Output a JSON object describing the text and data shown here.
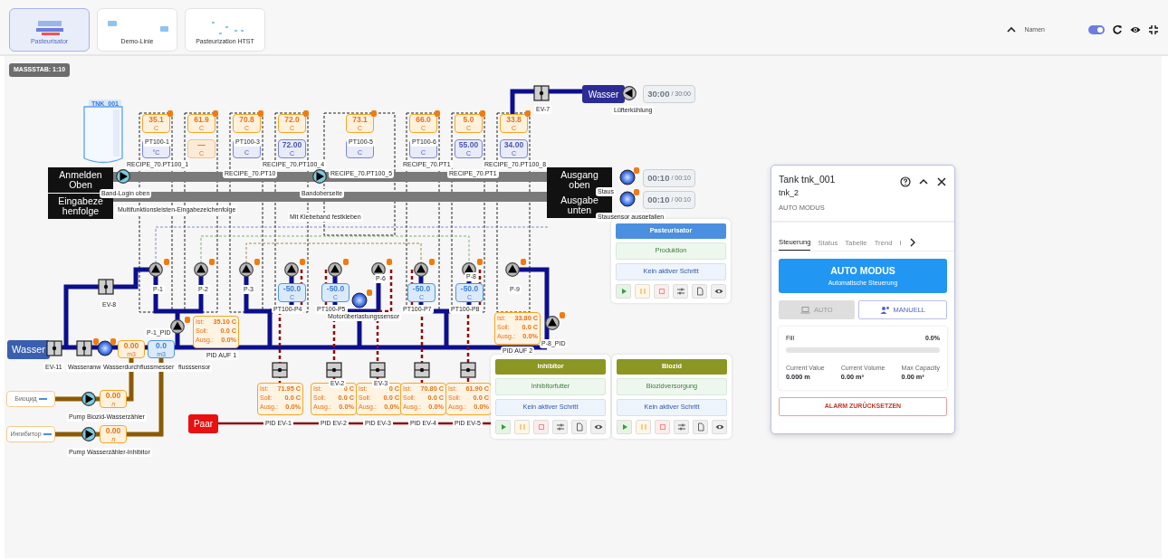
{
  "tabs": [
    {
      "label": "Pasteurisator",
      "selected": true
    },
    {
      "label": "Demo-Linie",
      "selected": false
    },
    {
      "label": "Pasteurization HTST",
      "selected": false
    }
  ],
  "toolbar": {
    "names_label": "Namen",
    "names_on": true
  },
  "scale": "MASSSTAB: 1:10",
  "tank": {
    "label": "TNK_001"
  },
  "sensors": [
    {
      "value": "35.1",
      "unit": "C",
      "set": {
        "unit": "°C",
        "kind": "normal"
      },
      "tag": "PT100-1",
      "recipe": "RECIPE_70.PT100_1"
    },
    {
      "value": "61.9",
      "unit": "C",
      "set": {
        "value": "—",
        "unit": "C",
        "kind": "warn"
      }
    },
    {
      "value": "70.8",
      "unit": "C",
      "set": {
        "unit": "C",
        "kind": "normal"
      },
      "tag": "PT100-3",
      "recipe": "RECIPE_70.PT10"
    },
    {
      "value": "72.0",
      "unit": "C",
      "set": {
        "value": "72.00",
        "unit": "C",
        "kind": "normal"
      },
      "recipe": "RECIPE_70.PT100_4"
    },
    {
      "value": "73.1",
      "unit": "C",
      "set": {
        "unit": "C",
        "kind": "normal"
      },
      "tag": "PT100-5",
      "recipe": "RECIPE_70.PT100_5"
    },
    {
      "value": "66.0",
      "unit": "C",
      "set": {
        "unit": "C",
        "kind": "normal"
      },
      "tag": "PT100-6",
      "recipe": "RECIPE_70.PT1"
    },
    {
      "value": "5.0",
      "unit": "C",
      "set": {
        "value": "55.00",
        "unit": "C",
        "kind": "normal"
      },
      "recipe": "RECIPE_70.PT1"
    },
    {
      "value": "33.8",
      "unit": "C",
      "set": {
        "value": "34.00",
        "unit": "C",
        "kind": "normal"
      },
      "recipe": "RECIPE_70.PT100_8"
    }
  ],
  "conveyor": {
    "inlets": [
      [
        "Anmelden",
        "Oben"
      ],
      [
        "Eingabeze",
        "henfolge"
      ]
    ],
    "outlets": [
      [
        "Ausgang",
        "oben"
      ],
      [
        "Ausgabe",
        "unten"
      ]
    ],
    "pumps": [
      {
        "label": "Band-Login oben"
      },
      {
        "label": "Multifunktionsleisten-Eingabezeichenfolge"
      },
      {
        "label": "Bandoberseite"
      },
      {
        "label": "Mit Klebeband festkleben"
      }
    ],
    "outlet_sensors": [
      {
        "label": "Staus",
        "time": "00:10",
        "total": "/ 00:10"
      },
      {
        "label": "Stausensor ausgefallen",
        "time": "00:10",
        "total": "/ 00:10"
      }
    ]
  },
  "cooling": {
    "source": "Wasser",
    "valve": "EV-7",
    "pump": "Lüfterkühlung",
    "time": "30:00",
    "total": "/ 30:00"
  },
  "pumps": [
    {
      "kind": "pump",
      "label": "P-1"
    },
    {
      "kind": "pump",
      "label": "P-2"
    },
    {
      "kind": "pump",
      "label": "P-3"
    },
    {
      "kind": "pump"
    },
    {
      "kind": "pump"
    },
    {
      "kind": "pump",
      "label": "P-6"
    },
    {
      "kind": "pump"
    },
    {
      "kind": "pump",
      "label": "P-8"
    },
    {
      "kind": "pump",
      "label": "P-9"
    }
  ],
  "probes": [
    {
      "value": "-50.0",
      "unit": "C",
      "label": "PT100-P4"
    },
    {
      "value": "-50.0",
      "unit": "C",
      "label": "PT100-P5"
    },
    {
      "value": "-50.0",
      "unit": "C",
      "label": "PT100-P7"
    },
    {
      "value": "-50.0",
      "unit": "C",
      "label": "PT100-P8"
    }
  ],
  "motor_sensor": "Motorüberlastungssensor",
  "pid_pumps": [
    {
      "label": "P-1_PID"
    },
    {
      "label": "P-8_PID"
    }
  ],
  "pids": [
    {
      "label": "PID AUF 1",
      "rows": [
        {
          "key": "Ist:",
          "value": "35.10 C"
        },
        {
          "key": "Soll:",
          "value": "0.0 C"
        },
        {
          "key": "Ausg.:",
          "value": "0.0%"
        }
      ]
    },
    {
      "label": "PID AUF 2",
      "rows": [
        {
          "key": "Ist:",
          "value": "33.80 C"
        },
        {
          "key": "Soll:",
          "value": "0.0 C"
        },
        {
          "key": "Ausg.:",
          "value": "0.0%"
        }
      ]
    },
    {
      "label": "PID EV-1",
      "rows": [
        {
          "key": "Ist:",
          "value": "71.95 C"
        },
        {
          "key": "Soll:",
          "value": "0.0 C"
        },
        {
          "key": "Ausg.:",
          "value": "0.0%"
        }
      ]
    },
    {
      "label": "PID EV-2",
      "rows": [
        {
          "key": "Ist:",
          "value": "0 C"
        },
        {
          "key": "Soll:",
          "value": "0.0 C"
        },
        {
          "key": "Ausg.:",
          "value": "0.0%"
        }
      ]
    },
    {
      "label": "PID EV-3",
      "rows": [
        {
          "key": "Ist:",
          "value": "0 C"
        },
        {
          "key": "Soll:",
          "value": "0.0 C"
        },
        {
          "key": "Ausg.:",
          "value": "0.0%"
        }
      ]
    },
    {
      "label": "PID EV-4",
      "rows": [
        {
          "key": "Ist:",
          "value": "70.80 C"
        },
        {
          "key": "Soll:",
          "value": "0.0 C"
        },
        {
          "key": "Ausg.:",
          "value": "0.0%"
        }
      ]
    },
    {
      "label": "PID EV-5",
      "rows": [
        {
          "key": "Ist:",
          "value": "61.90 C"
        },
        {
          "key": "Soll:",
          "value": "0.0 C"
        },
        {
          "key": "Ausg.:",
          "value": "0.0%"
        }
      ]
    }
  ],
  "valves": [
    {
      "kind": "valve"
    },
    {
      "kind": "valve",
      "label": "EV-2"
    },
    {
      "kind": "valve",
      "label": "EV-3"
    },
    {
      "kind": "valve"
    },
    {
      "kind": "valve"
    }
  ],
  "inlet": {
    "source": "Wasser",
    "valves": [
      {
        "label": "EV-11"
      },
      {
        "label": "Wasseranw"
      }
    ],
    "meters": [
      {
        "value": "0.00",
        "unit": "m3",
        "label": "Wasserdurchflussmesser"
      },
      {
        "value": "0.0",
        "unit": "m3",
        "label": "flusssensor"
      }
    ],
    "bypass_valve": "EV-8"
  },
  "dosing": [
    {
      "field": "Биоцид",
      "pump_label": "Pump",
      "value": "0.00",
      "unit": "л",
      "meter_label": "Biozid-Wasserzähler"
    },
    {
      "field": "Ингибитор",
      "pump_label": "Pump",
      "value": "0.00",
      "unit": "л",
      "meter_label": "Wasserzähler-Inhibitor"
    }
  ],
  "pair": "Paar",
  "sequences": [
    {
      "title": "Pasteurisator",
      "color": "#4a8fe0",
      "mode": "Produktion",
      "step": "Kein aktiver Schritt"
    },
    {
      "title": "Inhibitor",
      "color": "#8c9623",
      "mode": "Inhibitorfutter",
      "step": "Kein aktiver Schritt"
    },
    {
      "title": "Biozid",
      "color": "#8c9623",
      "mode": "Biozidversorgung",
      "step": "Kein aktiver Schritt"
    }
  ],
  "panel": {
    "title": "Tank tnk_001",
    "subtitle": "tnk_2",
    "mode": "AUTO MODUS",
    "tabs": [
      {
        "label": "Steuerung",
        "selected": true
      },
      {
        "label": "Status",
        "selected": false
      },
      {
        "label": "Tabelle",
        "selected": false
      },
      {
        "label": "Trend",
        "selected": false
      },
      {
        "label": "I",
        "selected": false
      }
    ],
    "banner": {
      "title": "AUTO MODUS",
      "subtitle": "Automatische Steuerung"
    },
    "modes": [
      {
        "label": "AUTO",
        "selected": true
      },
      {
        "label": "MANUELL",
        "selected": false
      }
    ],
    "fill": {
      "label": "Fill",
      "reading": "0.0%",
      "level": 0
    },
    "stats": [
      {
        "label": "Current Value",
        "value": "0.000 m"
      },
      {
        "label": "Current Volume",
        "value": "0.00 m³"
      },
      {
        "label": "Max Capacity",
        "value": "0.00 m³"
      }
    ],
    "reset": "ALARM ZURÜCKSETZEN"
  }
}
